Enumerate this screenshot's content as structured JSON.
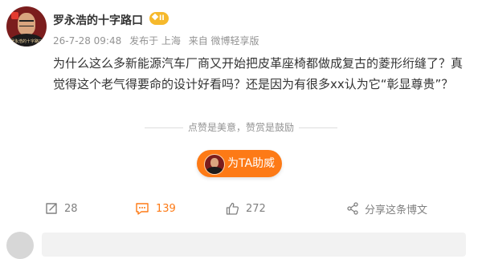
{
  "post": {
    "author": "罗永浩的十字路口",
    "level_badge": "II",
    "avatar_sign": "罗永浩的十字路口",
    "meta": {
      "time": "26-7-28 09:48",
      "location": "发布于 上海",
      "source": "来自 微博轻享版"
    },
    "content": "为什么这么多新能源汽车厂商又开始把皮革座椅都做成复古的菱形绗缝了？真觉得这个老气得要命的设计好看吗？还是因为有很多xx认为它“彰显尊贵”？",
    "encourage_text": "点赞是美意，赞赏是鼓励",
    "tip_button": "为TA助威"
  },
  "actions": {
    "reposts": "28",
    "comments": "139",
    "likes": "272",
    "share_label": "分享这条博文"
  },
  "colors": {
    "accent": "#fd7a16",
    "badge_gold": "#f6b92c",
    "muted_text": "#939393",
    "action_gray": "#808080"
  },
  "icons": {
    "repost": "repost-icon",
    "comment": "comment-icon",
    "like": "thumbs-up-icon",
    "share": "share-icon",
    "badge": "crown-badge-icon"
  }
}
